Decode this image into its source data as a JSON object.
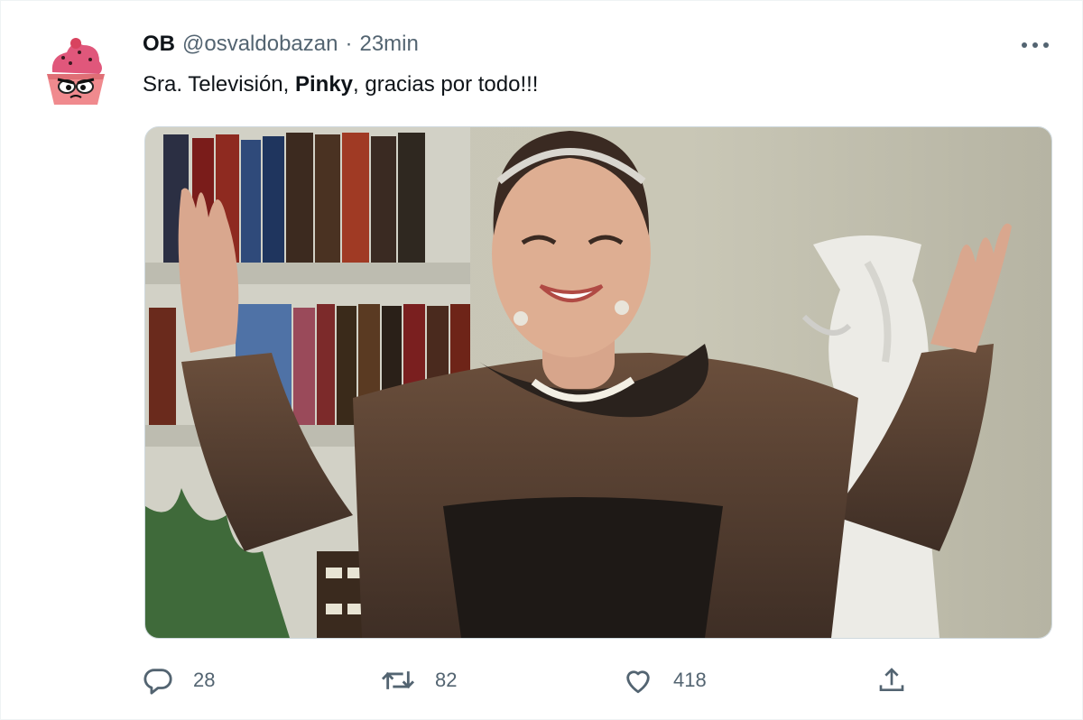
{
  "tweet": {
    "author_name": "OB",
    "author_handle": "@osvaldobazan",
    "separator": "·",
    "time": "23min",
    "text_before": "Sra. Televisión, ",
    "text_bold": "Pinky",
    "text_after": ", gracias por todo!!!"
  },
  "actions": {
    "reply_count": "28",
    "retweet_count": "82",
    "like_count": "418"
  },
  "icons": {
    "more": "more-horizontal-icon",
    "reply": "reply-icon",
    "retweet": "retweet-icon",
    "like": "heart-icon",
    "share": "share-icon"
  },
  "colors": {
    "text_primary": "#0f1419",
    "text_secondary": "#536471",
    "avatar_pink": "#e8747c"
  }
}
